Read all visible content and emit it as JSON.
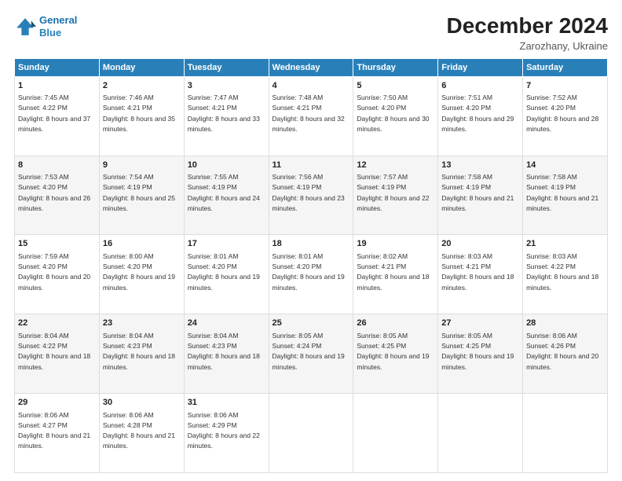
{
  "logo": {
    "line1": "General",
    "line2": "Blue"
  },
  "title": "December 2024",
  "subtitle": "Zarozhany, Ukraine",
  "weekdays": [
    "Sunday",
    "Monday",
    "Tuesday",
    "Wednesday",
    "Thursday",
    "Friday",
    "Saturday"
  ],
  "weeks": [
    [
      {
        "day": "1",
        "sunrise": "7:45 AM",
        "sunset": "4:22 PM",
        "daylight": "8 hours and 37 minutes."
      },
      {
        "day": "2",
        "sunrise": "7:46 AM",
        "sunset": "4:21 PM",
        "daylight": "8 hours and 35 minutes."
      },
      {
        "day": "3",
        "sunrise": "7:47 AM",
        "sunset": "4:21 PM",
        "daylight": "8 hours and 33 minutes."
      },
      {
        "day": "4",
        "sunrise": "7:48 AM",
        "sunset": "4:21 PM",
        "daylight": "8 hours and 32 minutes."
      },
      {
        "day": "5",
        "sunrise": "7:50 AM",
        "sunset": "4:20 PM",
        "daylight": "8 hours and 30 minutes."
      },
      {
        "day": "6",
        "sunrise": "7:51 AM",
        "sunset": "4:20 PM",
        "daylight": "8 hours and 29 minutes."
      },
      {
        "day": "7",
        "sunrise": "7:52 AM",
        "sunset": "4:20 PM",
        "daylight": "8 hours and 28 minutes."
      }
    ],
    [
      {
        "day": "8",
        "sunrise": "7:53 AM",
        "sunset": "4:20 PM",
        "daylight": "8 hours and 26 minutes."
      },
      {
        "day": "9",
        "sunrise": "7:54 AM",
        "sunset": "4:19 PM",
        "daylight": "8 hours and 25 minutes."
      },
      {
        "day": "10",
        "sunrise": "7:55 AM",
        "sunset": "4:19 PM",
        "daylight": "8 hours and 24 minutes."
      },
      {
        "day": "11",
        "sunrise": "7:56 AM",
        "sunset": "4:19 PM",
        "daylight": "8 hours and 23 minutes."
      },
      {
        "day": "12",
        "sunrise": "7:57 AM",
        "sunset": "4:19 PM",
        "daylight": "8 hours and 22 minutes."
      },
      {
        "day": "13",
        "sunrise": "7:58 AM",
        "sunset": "4:19 PM",
        "daylight": "8 hours and 21 minutes."
      },
      {
        "day": "14",
        "sunrise": "7:58 AM",
        "sunset": "4:19 PM",
        "daylight": "8 hours and 21 minutes."
      }
    ],
    [
      {
        "day": "15",
        "sunrise": "7:59 AM",
        "sunset": "4:20 PM",
        "daylight": "8 hours and 20 minutes."
      },
      {
        "day": "16",
        "sunrise": "8:00 AM",
        "sunset": "4:20 PM",
        "daylight": "8 hours and 19 minutes."
      },
      {
        "day": "17",
        "sunrise": "8:01 AM",
        "sunset": "4:20 PM",
        "daylight": "8 hours and 19 minutes."
      },
      {
        "day": "18",
        "sunrise": "8:01 AM",
        "sunset": "4:20 PM",
        "daylight": "8 hours and 19 minutes."
      },
      {
        "day": "19",
        "sunrise": "8:02 AM",
        "sunset": "4:21 PM",
        "daylight": "8 hours and 18 minutes."
      },
      {
        "day": "20",
        "sunrise": "8:03 AM",
        "sunset": "4:21 PM",
        "daylight": "8 hours and 18 minutes."
      },
      {
        "day": "21",
        "sunrise": "8:03 AM",
        "sunset": "4:22 PM",
        "daylight": "8 hours and 18 minutes."
      }
    ],
    [
      {
        "day": "22",
        "sunrise": "8:04 AM",
        "sunset": "4:22 PM",
        "daylight": "8 hours and 18 minutes."
      },
      {
        "day": "23",
        "sunrise": "8:04 AM",
        "sunset": "4:23 PM",
        "daylight": "8 hours and 18 minutes."
      },
      {
        "day": "24",
        "sunrise": "8:04 AM",
        "sunset": "4:23 PM",
        "daylight": "8 hours and 18 minutes."
      },
      {
        "day": "25",
        "sunrise": "8:05 AM",
        "sunset": "4:24 PM",
        "daylight": "8 hours and 19 minutes."
      },
      {
        "day": "26",
        "sunrise": "8:05 AM",
        "sunset": "4:25 PM",
        "daylight": "8 hours and 19 minutes."
      },
      {
        "day": "27",
        "sunrise": "8:05 AM",
        "sunset": "4:25 PM",
        "daylight": "8 hours and 19 minutes."
      },
      {
        "day": "28",
        "sunrise": "8:06 AM",
        "sunset": "4:26 PM",
        "daylight": "8 hours and 20 minutes."
      }
    ],
    [
      {
        "day": "29",
        "sunrise": "8:06 AM",
        "sunset": "4:27 PM",
        "daylight": "8 hours and 21 minutes."
      },
      {
        "day": "30",
        "sunrise": "8:06 AM",
        "sunset": "4:28 PM",
        "daylight": "8 hours and 21 minutes."
      },
      {
        "day": "31",
        "sunrise": "8:06 AM",
        "sunset": "4:29 PM",
        "daylight": "8 hours and 22 minutes."
      },
      null,
      null,
      null,
      null
    ]
  ],
  "labels": {
    "sunrise": "Sunrise:",
    "sunset": "Sunset:",
    "daylight": "Daylight:"
  }
}
